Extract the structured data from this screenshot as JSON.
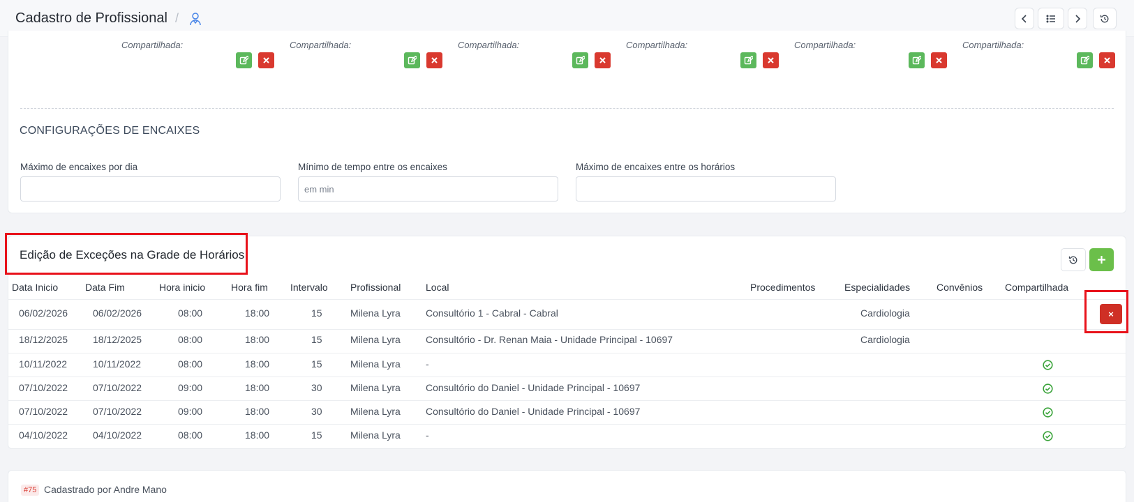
{
  "header": {
    "title": "Cadastro de Profissional",
    "separator": "/",
    "icon": "user-icon",
    "buttons": [
      "chevron-left-icon",
      "list-icon",
      "chevron-right-icon",
      "history-icon"
    ]
  },
  "shared_block": {
    "label": "Compartilhada:",
    "columns": 6
  },
  "encaixes": {
    "title": "CONFIGURAÇÕES DE ENCAIXES",
    "fields": [
      {
        "label": "Máximo de encaixes por dia",
        "value": "",
        "placeholder": ""
      },
      {
        "label": "Mínimo de tempo entre os encaixes",
        "value": "",
        "placeholder": "em min"
      },
      {
        "label": "Máximo de encaixes entre os horários",
        "value": "",
        "placeholder": ""
      }
    ]
  },
  "exceptions": {
    "title": "Edição de Exceções na Grade de Horários",
    "history_button_icon": "history-icon",
    "add_button_label": "+",
    "delete_label": "×",
    "columns": [
      "Data Inicio",
      "Data Fim",
      "Hora inicio",
      "Hora fim",
      "Intervalo",
      "Profissional",
      "Local",
      "Procedimentos",
      "Especialidades",
      "Convênios",
      "Compartilhada"
    ],
    "rows": [
      {
        "data_inicio": "06/02/2026",
        "data_fim": "06/02/2026",
        "hora_inicio": "08:00",
        "hora_fim": "18:00",
        "intervalo": "15",
        "profissional": "Milena Lyra",
        "local": "Consultório 1 - Cabral - Cabral",
        "procedimentos": "",
        "especialidades": "Cardiologia",
        "convenios": "",
        "compartilhada": false
      },
      {
        "data_inicio": "18/12/2025",
        "data_fim": "18/12/2025",
        "hora_inicio": "08:00",
        "hora_fim": "18:00",
        "intervalo": "15",
        "profissional": "Milena Lyra",
        "local": "Consultório - Dr. Renan Maia - Unidade Principal - 10697",
        "procedimentos": "",
        "especialidades": "Cardiologia",
        "convenios": "",
        "compartilhada": false
      },
      {
        "data_inicio": "10/11/2022",
        "data_fim": "10/11/2022",
        "hora_inicio": "08:00",
        "hora_fim": "18:00",
        "intervalo": "15",
        "profissional": "Milena Lyra",
        "local": "-",
        "procedimentos": "",
        "especialidades": "",
        "convenios": "",
        "compartilhada": true
      },
      {
        "data_inicio": "07/10/2022",
        "data_fim": "07/10/2022",
        "hora_inicio": "09:00",
        "hora_fim": "18:00",
        "intervalo": "30",
        "profissional": "Milena Lyra",
        "local": "Consultório do Daniel - Unidade Principal - 10697",
        "procedimentos": "",
        "especialidades": "",
        "convenios": "",
        "compartilhada": true
      },
      {
        "data_inicio": "07/10/2022",
        "data_fim": "07/10/2022",
        "hora_inicio": "09:00",
        "hora_fim": "18:00",
        "intervalo": "30",
        "profissional": "Milena Lyra",
        "local": "Consultório do Daniel - Unidade Principal - 10697",
        "procedimentos": "",
        "especialidades": "",
        "convenios": "",
        "compartilhada": true
      },
      {
        "data_inicio": "04/10/2022",
        "data_fim": "04/10/2022",
        "hora_inicio": "08:00",
        "hora_fim": "18:00",
        "intervalo": "15",
        "profissional": "Milena Lyra",
        "local": "-",
        "procedimentos": "",
        "especialidades": "",
        "convenios": "",
        "compartilhada": true
      }
    ]
  },
  "footer": {
    "id_tag": "#75",
    "created_by": "Cadastrado por Andre Mano"
  },
  "colors": {
    "edit_green": "#5cb85c",
    "delete_red": "#d9392f",
    "add_green": "#6bbf4a",
    "check_green": "#3aa33a",
    "highlight_red": "#e8121b"
  }
}
